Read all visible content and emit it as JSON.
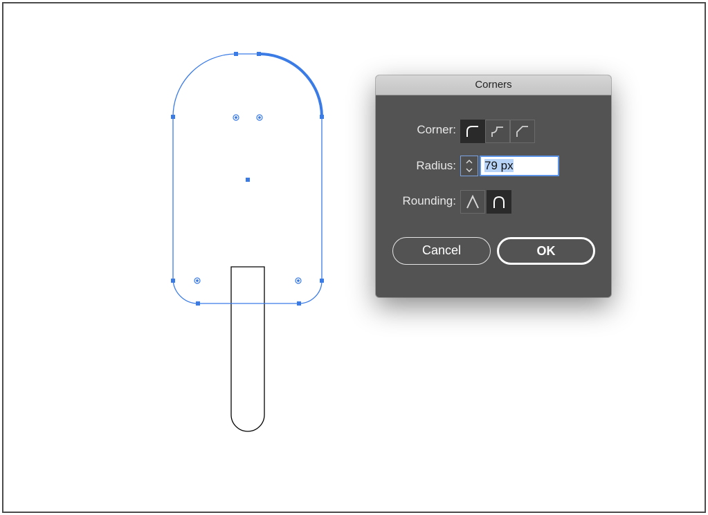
{
  "canvas": {
    "colors": {
      "selection": "#3a7be6",
      "stroke": "#000000",
      "border": "#4a4a4a"
    }
  },
  "dialog": {
    "title": "Corners",
    "corner": {
      "label": "Corner:",
      "options": [
        {
          "icon": "round-corner-icon",
          "selected": true
        },
        {
          "icon": "inverted-round-corner-icon",
          "selected": false
        },
        {
          "icon": "chamfer-corner-icon",
          "selected": false
        }
      ]
    },
    "radius": {
      "label": "Radius:",
      "value": "79 px"
    },
    "rounding": {
      "label": "Rounding:",
      "options": [
        {
          "icon": "absolute-rounding-icon",
          "selected": false
        },
        {
          "icon": "relative-rounding-icon",
          "selected": true
        }
      ]
    },
    "buttons": {
      "cancel": "Cancel",
      "ok": "OK"
    }
  }
}
